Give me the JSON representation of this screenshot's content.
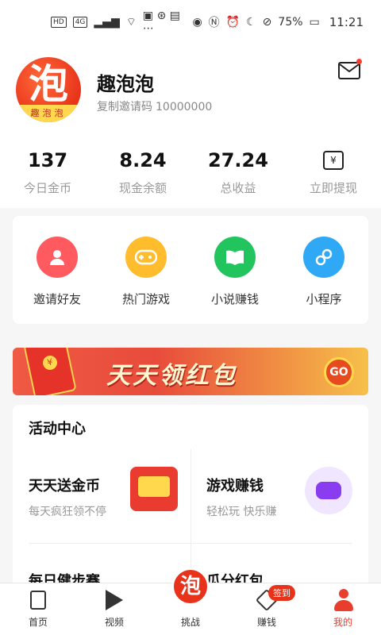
{
  "status_bar": {
    "left_badges": [
      "HD",
      "4G"
    ],
    "battery": "75%",
    "time": "11:21"
  },
  "profile": {
    "avatar_glyph": "泡",
    "avatar_band_text": "趣泡泡",
    "name": "趣泡泡",
    "invite_label": "复制邀请码",
    "invite_code": "10000000"
  },
  "stats": [
    {
      "value": "137",
      "label": "今日金币"
    },
    {
      "value": "8.24",
      "label": "现金余额"
    },
    {
      "value": "27.24",
      "label": "总收益"
    }
  ],
  "withdraw": {
    "icon": "wallet-icon",
    "label": "立即提现",
    "glyph": "¥"
  },
  "shortcuts": [
    {
      "label": "邀请好友",
      "icon": "invite-friend-icon",
      "color": "#ff5a5f"
    },
    {
      "label": "热门游戏",
      "icon": "gamepad-icon",
      "color": "#ffbd2e"
    },
    {
      "label": "小说赚钱",
      "icon": "book-icon",
      "color": "#22c45e"
    },
    {
      "label": "小程序",
      "icon": "mini-program-icon",
      "color": "#2fa8f5"
    }
  ],
  "banner": {
    "text": "天天领红包",
    "go": "GO",
    "coin": "¥"
  },
  "activity": {
    "title": "活动中心",
    "items": [
      {
        "name": "天天送金币",
        "sub": "每天疯狂领不停"
      },
      {
        "name": "游戏赚钱",
        "sub": "轻松玩 快乐赚"
      },
      {
        "name": "每日健步赛",
        "sub": ""
      },
      {
        "name": "瓜分红包",
        "sub": ""
      }
    ]
  },
  "tabbar": {
    "tabs": [
      {
        "label": "首页",
        "icon": "home-doc-icon"
      },
      {
        "label": "视频",
        "icon": "play-icon"
      },
      {
        "label": "挑战",
        "icon": "challenge-ball-icon",
        "glyph": "泡"
      },
      {
        "label": "赚钱",
        "icon": "earn-icon",
        "badge": "签到"
      },
      {
        "label": "我的",
        "icon": "profile-icon"
      }
    ],
    "active_index": 4
  },
  "colors": {
    "accent": "#e83e2d",
    "brand": "#e8321a"
  }
}
